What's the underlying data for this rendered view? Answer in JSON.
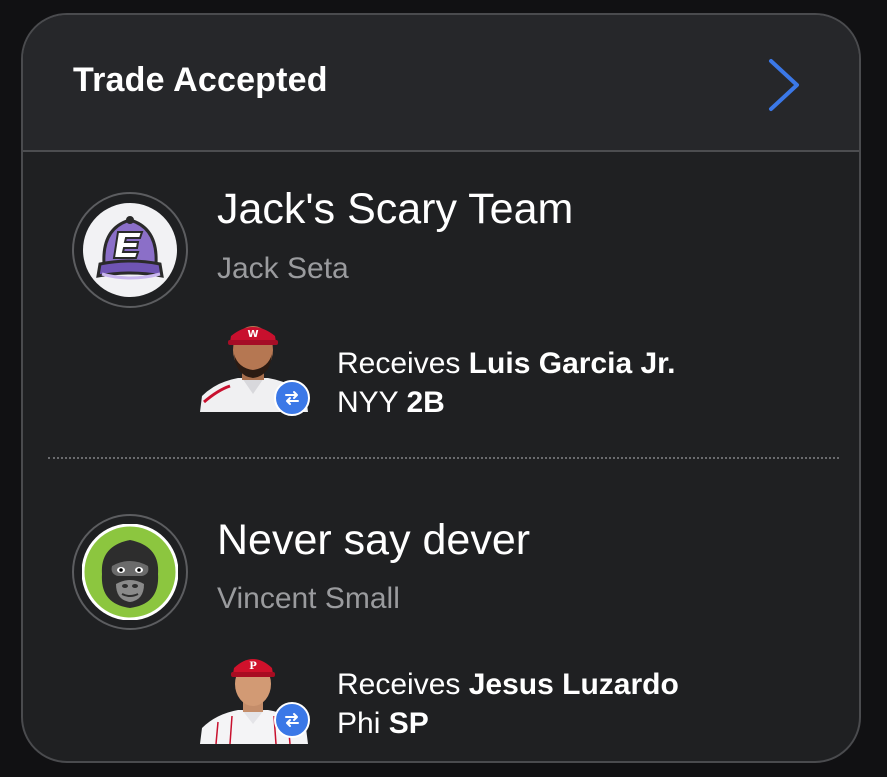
{
  "header": {
    "title": "Trade Accepted",
    "chevron_icon": "chevron-right-icon"
  },
  "teams": [
    {
      "name": "Jack's Scary Team",
      "owner": "Jack Seta",
      "logo_icon": "purple-cap-logo-icon",
      "receives_label": "Receives",
      "player": "Luis Garcia Jr.",
      "team_abbr": "NYY",
      "position": "2B"
    },
    {
      "name": "Never say dever",
      "owner": "Vincent Small",
      "logo_icon": "gorilla-logo-icon",
      "receives_label": "Receives",
      "player": "Jesus Luzardo",
      "team_abbr": "Phi",
      "position": "SP"
    }
  ],
  "colors": {
    "accent": "#3b78e7",
    "card_bg": "#1f2022",
    "header_bg": "#26272a",
    "muted_text": "#9a9b9e"
  }
}
